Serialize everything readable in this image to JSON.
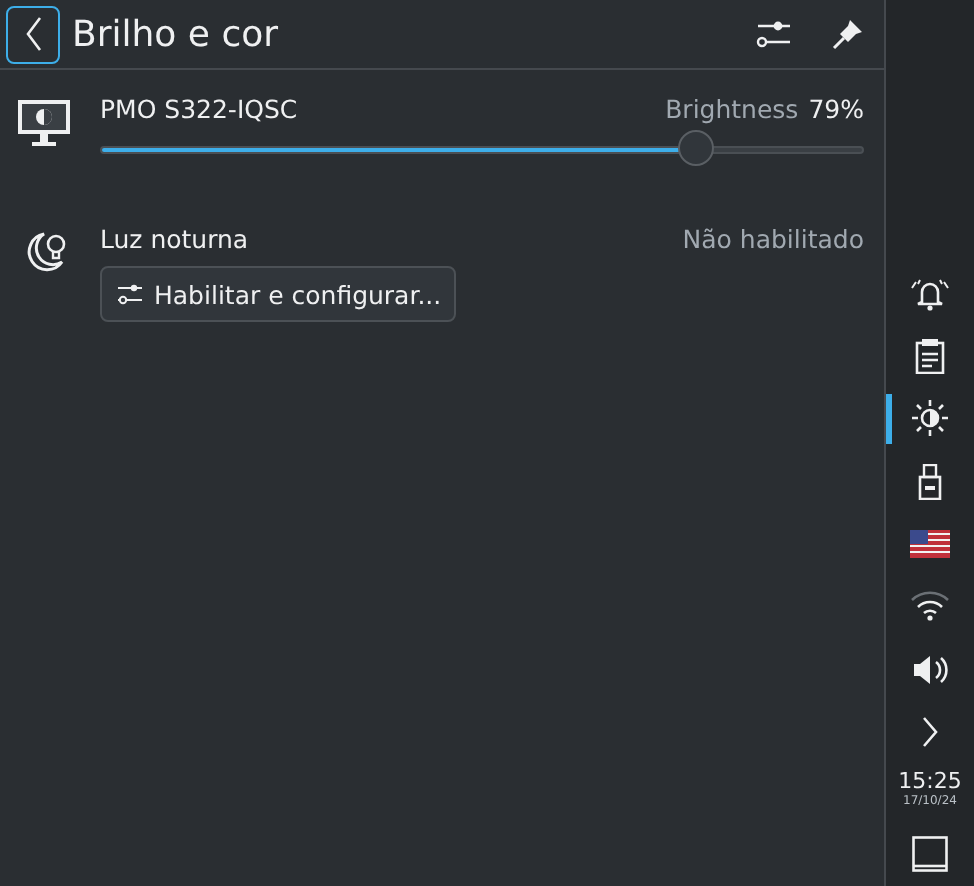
{
  "header": {
    "title": "Brilho e cor"
  },
  "displays": [
    {
      "name": "PMO S322-IQSC",
      "label": "Brightness",
      "reading": "79%",
      "level": 0.78
    }
  ],
  "night_light": {
    "title": "Luz noturna",
    "status": "Não habilitado",
    "button": "Habilitar e configurar..."
  },
  "tray": [
    {
      "kind": "bell",
      "selected": false
    },
    {
      "kind": "clipboard",
      "selected": false
    },
    {
      "kind": "brightness",
      "selected": true
    },
    {
      "kind": "usb",
      "selected": false
    },
    {
      "kind": "flag",
      "selected": false
    },
    {
      "kind": "wifi",
      "selected": false
    },
    {
      "kind": "volume",
      "selected": false
    },
    {
      "kind": "expand",
      "selected": false
    }
  ],
  "clock": {
    "time": "15:25",
    "date": "17/10/24"
  }
}
